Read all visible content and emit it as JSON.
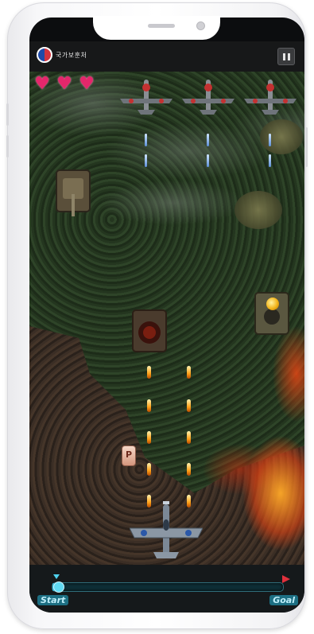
{
  "app": {
    "logo_text": "국가보훈처"
  },
  "hud": {
    "lives": 3,
    "pause_icon": "pause-icon",
    "heart_color": "#e4276b"
  },
  "progress": {
    "start_label": "Start",
    "goal_label": "Goal",
    "value_fraction": 0.01
  },
  "entities": {
    "enemy_planes": 3,
    "enemy_tanks": 3,
    "player": "fighter-plane",
    "powerup_label": "P"
  },
  "colors": {
    "accent": "#38b7d8",
    "lava": "#e6461a",
    "forest": "#283b23"
  }
}
